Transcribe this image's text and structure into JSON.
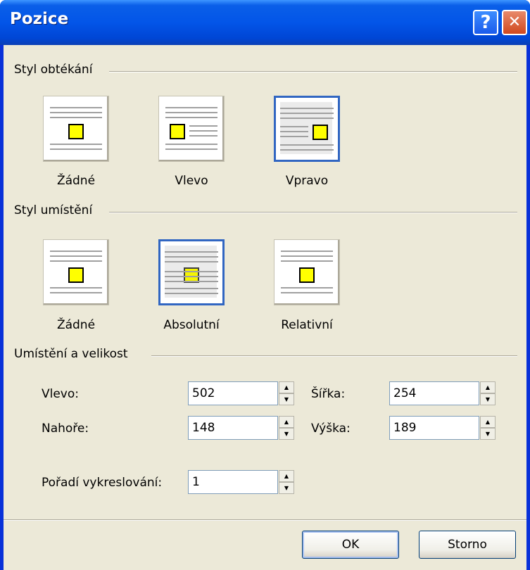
{
  "dialog": {
    "title": "Pozice",
    "help_glyph": "?",
    "close_glyph": "✕"
  },
  "wrap_style": {
    "label": "Styl obtékání",
    "options": [
      {
        "label": "Žádné",
        "selected": false,
        "icon": "wrap-none-icon"
      },
      {
        "label": "Vlevo",
        "selected": false,
        "icon": "wrap-left-icon"
      },
      {
        "label": "Vpravo",
        "selected": true,
        "icon": "wrap-right-icon"
      }
    ]
  },
  "position_style": {
    "label": "Styl umístění",
    "options": [
      {
        "label": "Žádné",
        "selected": false,
        "icon": "position-none-icon"
      },
      {
        "label": "Absolutní",
        "selected": true,
        "icon": "position-absolute-icon"
      },
      {
        "label": "Relativní",
        "selected": false,
        "icon": "position-relative-icon"
      }
    ]
  },
  "placement": {
    "label": "Umístění a velikost",
    "left_label": "Vlevo:",
    "left_value": "502",
    "top_label": "Nahoře:",
    "top_value": "148",
    "width_label": "Šířka:",
    "width_value": "254",
    "height_label": "Výška:",
    "height_value": "189",
    "z_order_label": "Pořadí vykreslování:",
    "z_order_value": "1"
  },
  "buttons": {
    "ok": "OK",
    "cancel": "Storno"
  },
  "colors": {
    "title_bar": "#0a5fe8",
    "dialog_bg": "#ece9d8",
    "selected_border": "#3166c2",
    "marker": "#ffff00"
  }
}
